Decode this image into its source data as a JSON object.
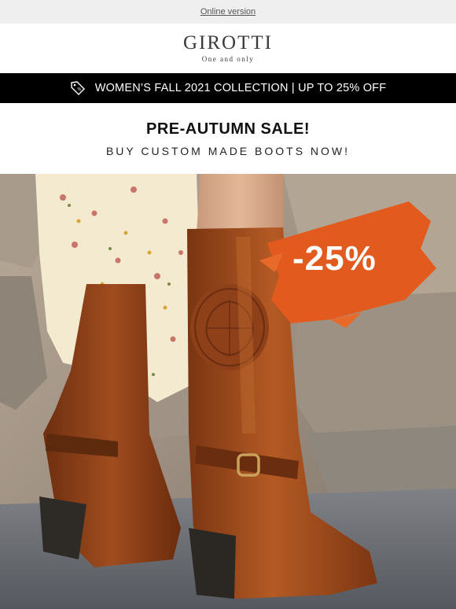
{
  "header": {
    "online_version_link": "Online version"
  },
  "brand": {
    "logo_text": "GIROTTI",
    "tagline": "One and only"
  },
  "promo_bar": {
    "icon": "price-tag-icon",
    "text": "WOMEN’S FALL 2021 COLLECTION | UP TO 25% OFF"
  },
  "headline": {
    "title": "PRE-AUTUMN SALE!",
    "subtitle": "BUY CUSTOM MADE BOOTS NOW!"
  },
  "hero": {
    "discount_badge": "-25%",
    "badge_color": "#e35a1f",
    "boot_color": "#a24a1c"
  }
}
